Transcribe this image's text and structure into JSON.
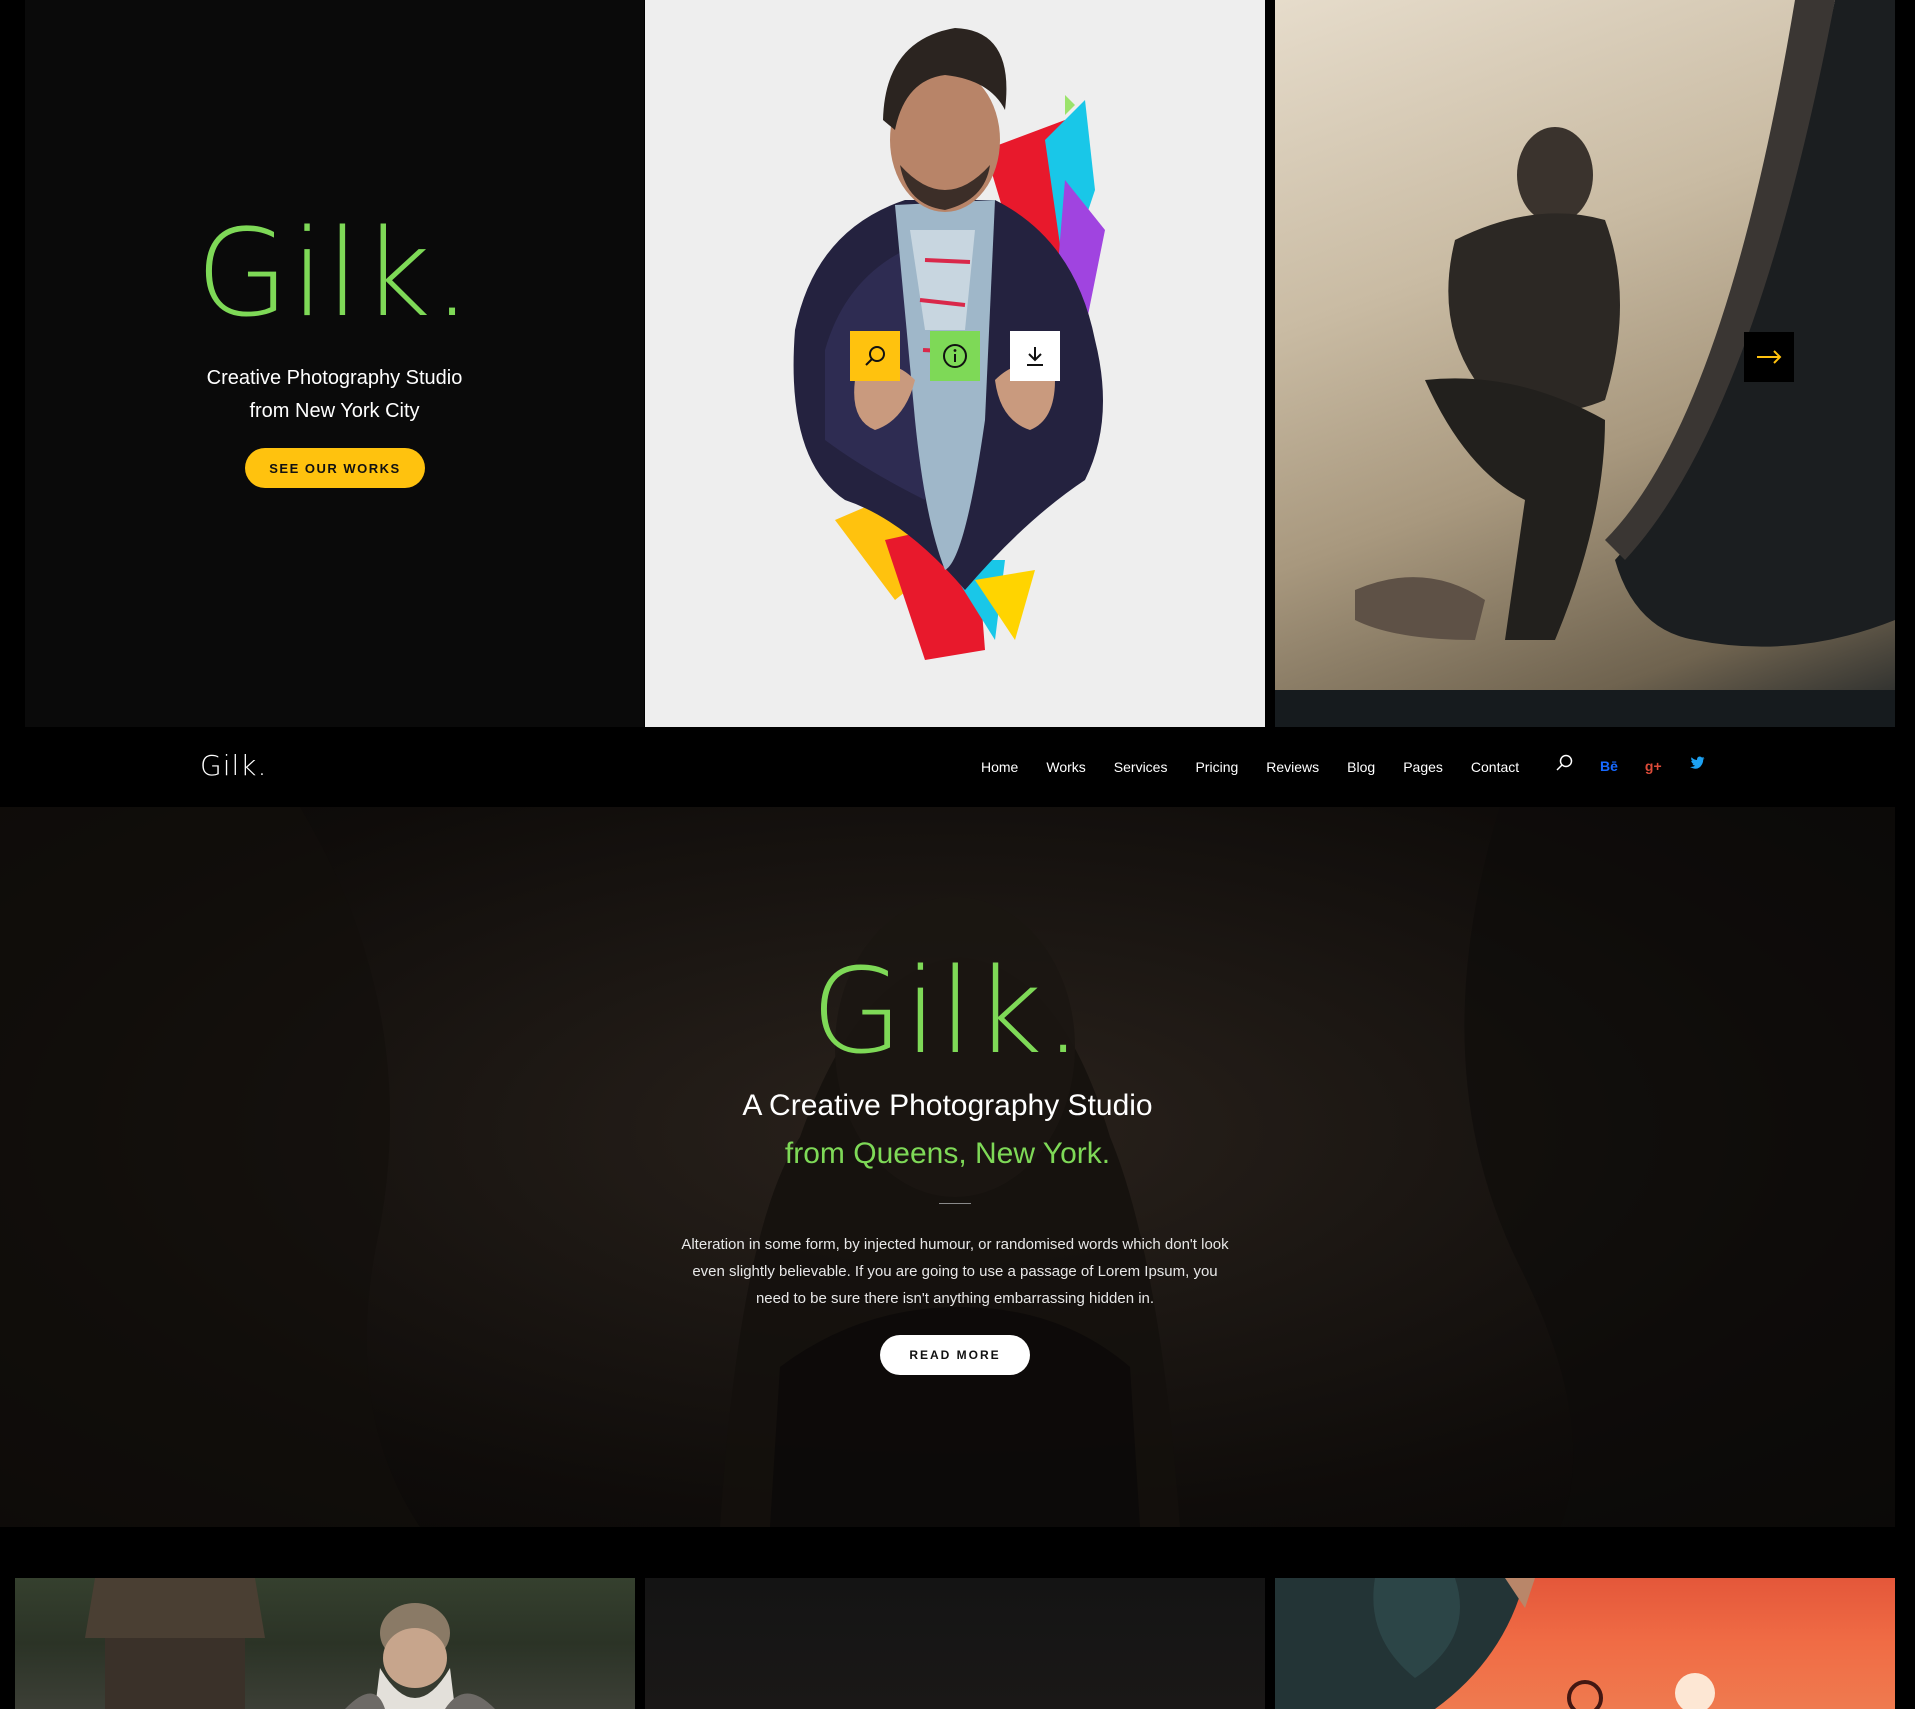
{
  "intro": {
    "logo": "Gilk.",
    "subtitle_line1": "Creative Photography Studio",
    "subtitle_line2": "from New York City",
    "button_label": "SEE OUR WORKS"
  },
  "overlay_icons": [
    "search-icon",
    "info-icon",
    "download-icon"
  ],
  "slider": {
    "next_icon": "arrow-right-icon"
  },
  "nav": {
    "logo": "Gilk.",
    "items": [
      "Home",
      "Works",
      "Services",
      "Pricing",
      "Reviews",
      "Blog",
      "Pages",
      "Contact"
    ],
    "search_icon": "search-icon",
    "social": [
      {
        "name": "behance-icon",
        "label": "Bē",
        "color": "#1769ff"
      },
      {
        "name": "google-plus-icon",
        "label": "g+",
        "color": "#dd4b39"
      },
      {
        "name": "twitter-icon",
        "label": "",
        "color": "#1da1f2"
      }
    ]
  },
  "hero": {
    "logo": "Gilk.",
    "title": "A Creative Photography Studio",
    "subtitle": "from Queens, New York.",
    "text": "Alteration in some form, by injected humour, or randomised words which don't look even slightly believable. If you are going to use a passage of Lorem Ipsum, you need to be sure there isn't anything embarrassing hidden in.",
    "button_label": "READ MORE"
  },
  "colors": {
    "accent_green": "#7ed957",
    "accent_yellow": "#ffc20e",
    "background": "#000000"
  }
}
